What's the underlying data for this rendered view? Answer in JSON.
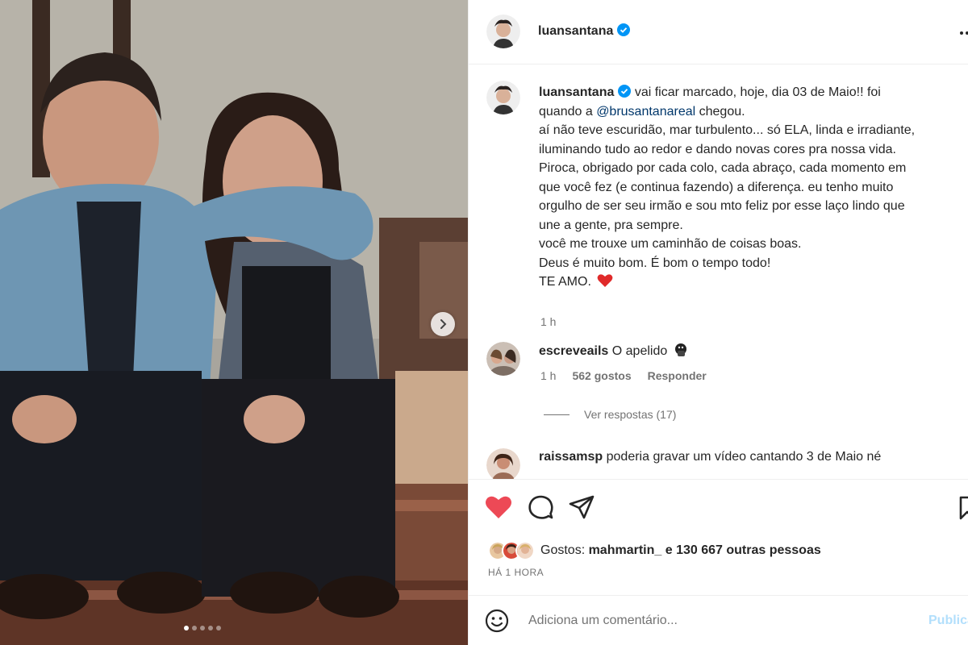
{
  "post": {
    "username": "luansantana",
    "verified": true,
    "more_icon": "more-horizontal-icon"
  },
  "caption": {
    "username": "luansantana",
    "lines": [
      "vai ficar marcado, hoje, dia 03 de Maio!! foi",
      "quando a ",
      "@brusantanareal",
      " chegou.",
      "aí não teve escuridão, mar turbulento... só ELA, linda e irradiante,",
      "iluminando tudo ao redor e dando novas cores pra nossa vida.",
      "Piroca, obrigado por cada colo, cada abraço, cada momento em",
      "que você fez (e continua fazendo) a diferença. eu tenho muito",
      "orgulho de ser seu irmão e sou mto feliz por esse laço lindo que",
      "une a gente, pra sempre.",
      "você me trouxe um caminhão de coisas boas.",
      "Deus é muito bom. É bom o tempo todo!",
      "TE AMO."
    ],
    "time": "1 h"
  },
  "comments": [
    {
      "username": "escreveails",
      "text": "O apelido",
      "time": "1 h",
      "likes": "562 gostos",
      "reply": "Responder"
    },
    {
      "username": "raissamsp",
      "text": "poderia gravar um vídeo cantando 3 de Maio né"
    }
  ],
  "view_replies": "Ver respostas (17)",
  "likes": {
    "prefix": "Gostos: ",
    "user": "mahmartin_",
    "rest": " e 130 667 outras pessoas"
  },
  "timestamp": "HÁ 1 HORA",
  "add_comment": {
    "placeholder": "Adiciona um comentário...",
    "publish": "Publicar"
  },
  "carousel": {
    "total": 5,
    "active": 0
  },
  "colors": {
    "like_red": "#ed4956",
    "verified_blue": "#0095f6",
    "mention": "#00376b",
    "muted": "#737373"
  }
}
